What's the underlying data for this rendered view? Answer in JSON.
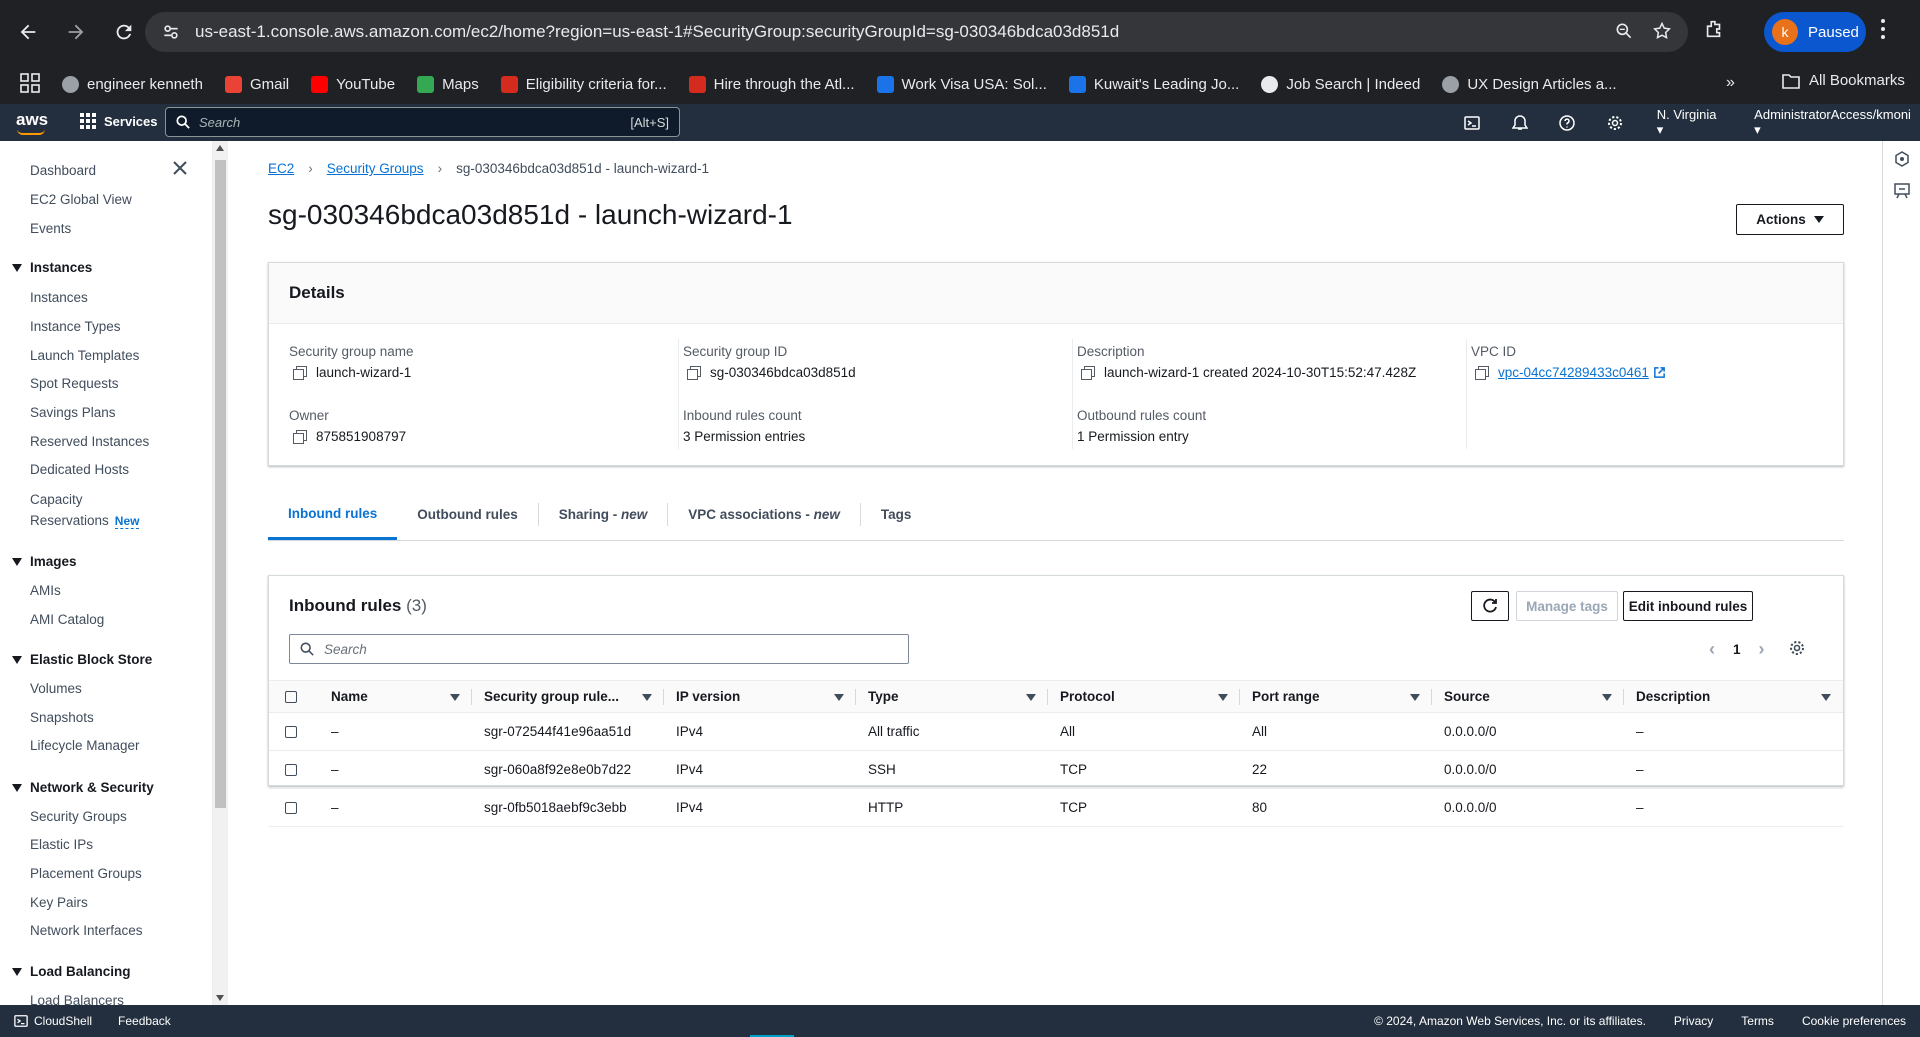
{
  "browser": {
    "url": "us-east-1.console.aws.amazon.com/ec2/home?region=us-east-1#SecurityGroup:securityGroupId=sg-030346bdca03d851d",
    "profile_initial": "k",
    "profile_status": "Paused",
    "bookmarks": [
      {
        "label": "engineer kenneth",
        "icon": "globe-icon",
        "color": "#9aa0a6"
      },
      {
        "label": "Gmail",
        "icon": "gmail-icon",
        "color": "#ea4335"
      },
      {
        "label": "YouTube",
        "icon": "youtube-icon",
        "color": "#ff0000"
      },
      {
        "label": "Maps",
        "icon": "maps-icon",
        "color": "#34a853"
      },
      {
        "label": "Eligibility criteria for...",
        "icon": "maple-leaf-icon",
        "color": "#d52b1e"
      },
      {
        "label": "Hire through the Atl...",
        "icon": "maple-leaf-icon",
        "color": "#d52b1e"
      },
      {
        "label": "Work Visa USA: Sol...",
        "icon": "check-badge-icon",
        "color": "#1a73e8"
      },
      {
        "label": "Kuwait's Leading Jo...",
        "icon": "job-site-icon",
        "color": "#1a73e8"
      },
      {
        "label": "Job Search | Indeed",
        "icon": "indeed-icon",
        "color": "#e8eaed"
      },
      {
        "label": "UX Design Articles a...",
        "icon": "ux-site-icon",
        "color": "#9aa0a6"
      }
    ],
    "all_bookmarks": "All Bookmarks"
  },
  "aws_nav": {
    "logo": "aws",
    "services": "Services",
    "search_placeholder": "Search",
    "search_hint": "[Alt+S]",
    "region": "N. Virginia",
    "account": "AdministratorAccess/kmoni"
  },
  "sidebar": {
    "top_items": [
      "Dashboard",
      "EC2 Global View",
      "Events"
    ],
    "sections": [
      {
        "title": "Instances",
        "items": [
          "Instances",
          "Instance Types",
          "Launch Templates",
          "Spot Requests",
          "Savings Plans",
          "Reserved Instances",
          "Dedicated Hosts",
          "Capacity",
          "Reservations"
        ]
      },
      {
        "title": "Images",
        "items": [
          "AMIs",
          "AMI Catalog"
        ]
      },
      {
        "title": "Elastic Block Store",
        "items": [
          "Volumes",
          "Snapshots",
          "Lifecycle Manager"
        ]
      },
      {
        "title": "Network & Security",
        "items": [
          "Security Groups",
          "Elastic IPs",
          "Placement Groups",
          "Key Pairs",
          "Network Interfaces"
        ]
      },
      {
        "title": "Load Balancing",
        "items": [
          "Load Balancers"
        ]
      }
    ],
    "new_badge": "New"
  },
  "breadcrumb": {
    "ec2": "EC2",
    "security_groups": "Security Groups",
    "current": "sg-030346bdca03d851d - launch-wizard-1"
  },
  "page_title": "sg-030346bdca03d851d - launch-wizard-1",
  "actions_label": "Actions",
  "details": {
    "title": "Details",
    "sg_name_label": "Security group name",
    "sg_name": "launch-wizard-1",
    "sg_id_label": "Security group ID",
    "sg_id": "sg-030346bdca03d851d",
    "description_label": "Description",
    "description": "launch-wizard-1 created 2024-10-30T15:52:47.428Z",
    "vpc_label": "VPC ID",
    "vpc_id": "vpc-04cc74289433c0461",
    "owner_label": "Owner",
    "owner": "875851908797",
    "inbound_count_label": "Inbound rules count",
    "inbound_count": "3 Permission entries",
    "outbound_count_label": "Outbound rules count",
    "outbound_count": "1 Permission entry"
  },
  "tabs": {
    "inbound": "Inbound rules",
    "outbound": "Outbound rules",
    "sharing": "Sharing - ",
    "sharing_new": "new",
    "vpc_assoc": "VPC associations - ",
    "vpc_assoc_new": "new",
    "tags": "Tags"
  },
  "inbound": {
    "title": "Inbound rules",
    "count": "(3)",
    "manage_tags": "Manage tags",
    "edit_rules": "Edit inbound rules",
    "search_placeholder": "Search",
    "page": "1",
    "columns": [
      "Name",
      "Security group rule...",
      "IP version",
      "Type",
      "Protocol",
      "Port range",
      "Source",
      "Description"
    ],
    "rows": [
      {
        "name": "–",
        "rule_id": "sgr-072544f41e96aa51d",
        "ip_version": "IPv4",
        "type": "All traffic",
        "protocol": "All",
        "port_range": "All",
        "source": "0.0.0.0/0",
        "description": "–"
      },
      {
        "name": "–",
        "rule_id": "sgr-060a8f92e8e0b7d22",
        "ip_version": "IPv4",
        "type": "SSH",
        "protocol": "TCP",
        "port_range": "22",
        "source": "0.0.0.0/0",
        "description": "–"
      },
      {
        "name": "–",
        "rule_id": "sgr-0fb5018aebf9c3ebb",
        "ip_version": "IPv4",
        "type": "HTTP",
        "protocol": "TCP",
        "port_range": "80",
        "source": "0.0.0.0/0",
        "description": "–"
      }
    ]
  },
  "footer": {
    "cloudshell": "CloudShell",
    "feedback": "Feedback",
    "copyright": "© 2024, Amazon Web Services, Inc. or its affiliates.",
    "privacy": "Privacy",
    "terms": "Terms",
    "cookies": "Cookie preferences"
  }
}
